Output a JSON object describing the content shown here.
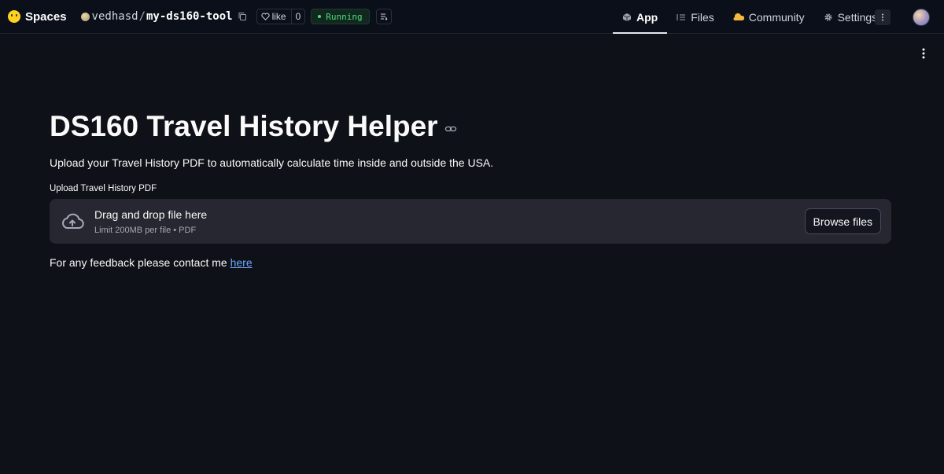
{
  "topbar": {
    "brand": "Spaces",
    "owner": "vedhasd",
    "separator": "/",
    "space_name": "my-ds160-tool",
    "like_label": "like",
    "like_count": "0",
    "status": "Running",
    "tabs": [
      {
        "label": "App",
        "icon": "cube-icon",
        "active": true
      },
      {
        "label": "Files",
        "icon": "files-icon",
        "active": false
      },
      {
        "label": "Community",
        "icon": "community-icon",
        "active": false
      },
      {
        "label": "Settings",
        "icon": "gear-icon",
        "active": false
      }
    ]
  },
  "main": {
    "title": "DS160 Travel History Helper",
    "subtitle": "Upload your Travel History PDF to automatically calculate time inside and outside the USA.",
    "uploader": {
      "label": "Upload Travel History PDF",
      "drag_text": "Drag and drop file here",
      "limit_text": "Limit 200MB per file • PDF",
      "browse_label": "Browse files"
    },
    "feedback": {
      "text": "For any feedback please contact me ",
      "link_text": "here"
    }
  },
  "colors": {
    "background": "#0e1117",
    "topbar": "#0b0f19",
    "dropzone": "#262730",
    "link": "#6ea8fe",
    "status": "#4ade80",
    "brand_logo": "#ffd21e"
  }
}
